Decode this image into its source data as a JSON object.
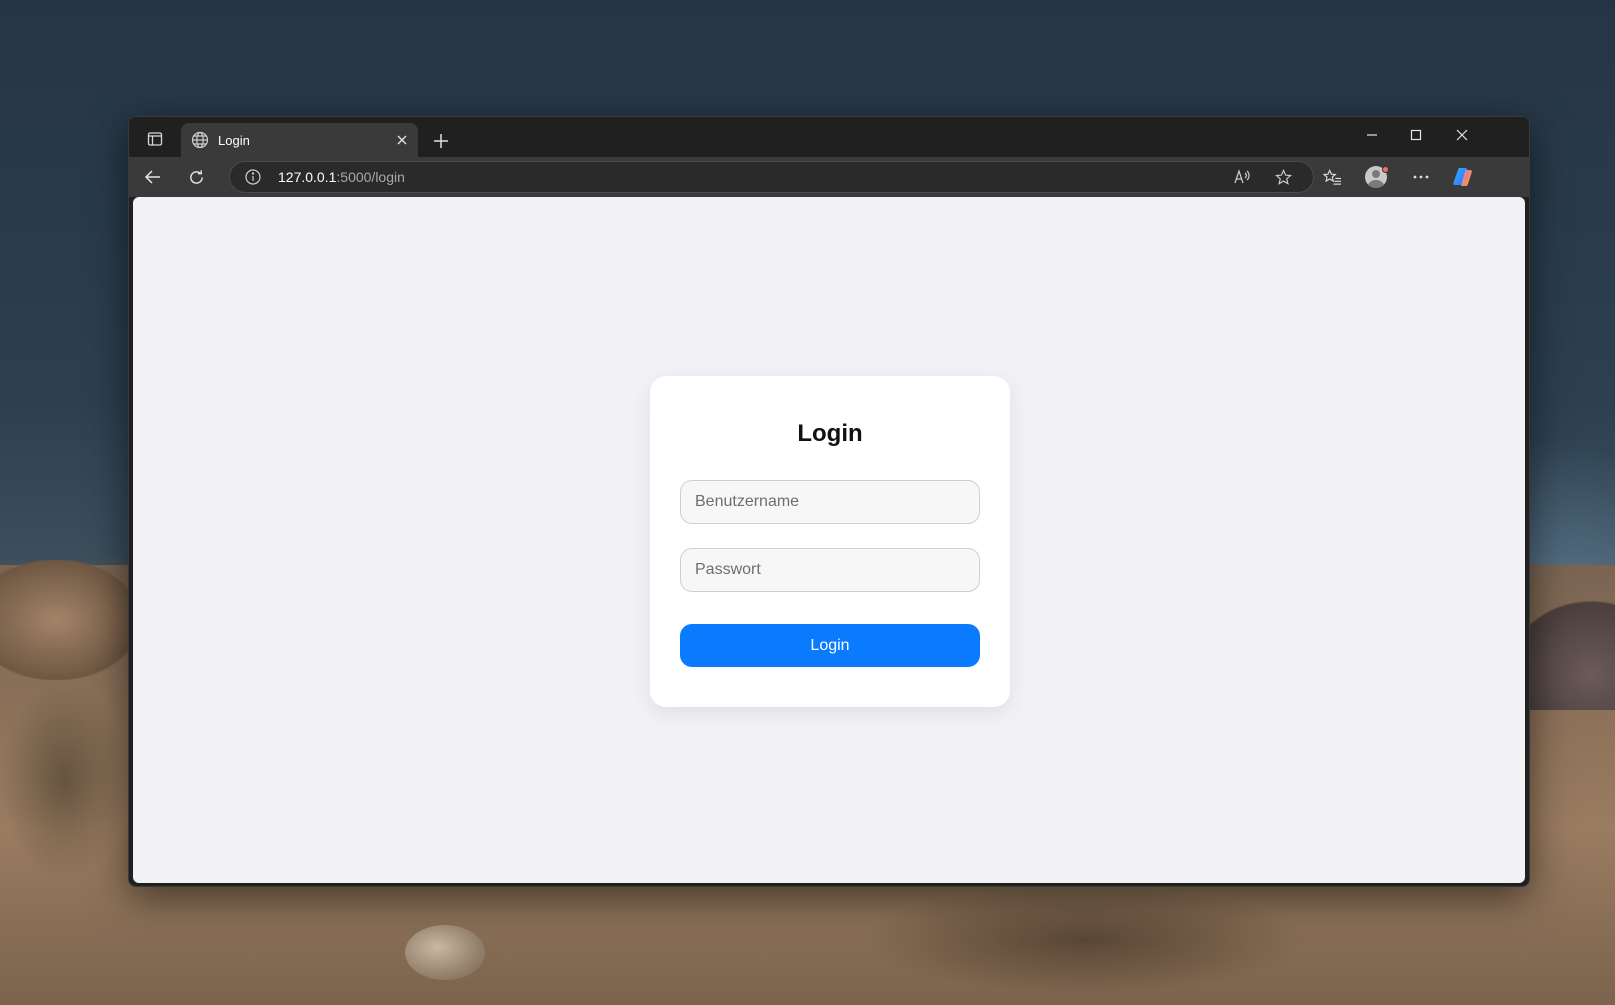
{
  "browser": {
    "tab": {
      "title": "Login",
      "icon": "globe-icon"
    },
    "address": {
      "host": "127.0.0.1",
      "rest": ":5000/login"
    },
    "icons": {
      "tab_actions": "tab-actions-icon",
      "new_tab": "plus-icon",
      "back": "back-arrow-icon",
      "refresh": "refresh-icon",
      "site_info": "info-icon",
      "read_aloud": "read-aloud-icon",
      "favorite": "star-icon",
      "favorites": "favorites-icon",
      "profile": "avatar",
      "more": "more-icon",
      "copilot": "copilot-icon",
      "minimize": "minimize-icon",
      "maximize": "maximize-icon",
      "close": "close-icon"
    }
  },
  "login": {
    "title": "Login",
    "username_placeholder": "Benutzername",
    "password_placeholder": "Passwort",
    "button_label": "Login"
  },
  "colors": {
    "accent": "#0a7bff",
    "page_background": "#f1f1f6",
    "card_background": "#ffffff"
  }
}
